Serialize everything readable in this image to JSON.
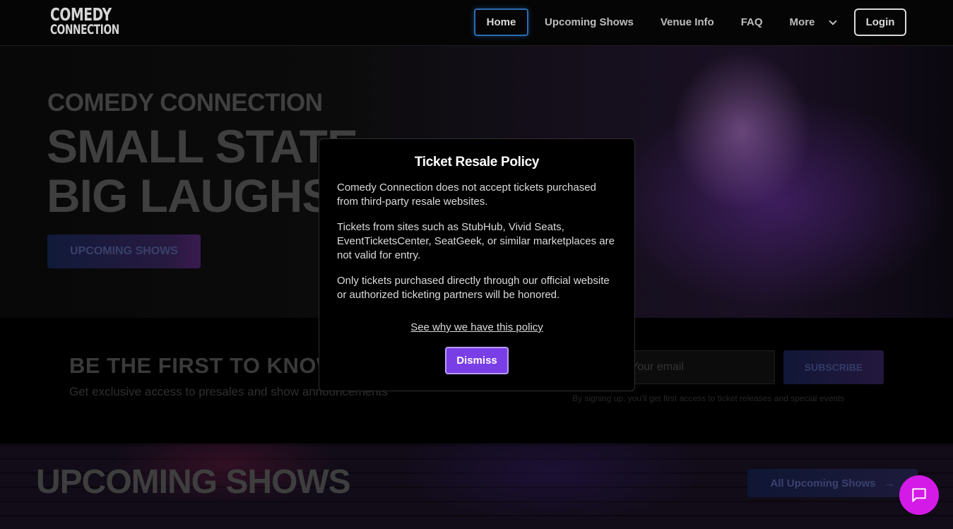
{
  "header": {
    "logo": {
      "line1": "COMEDY",
      "line2": "CONNECTION"
    },
    "nav": [
      {
        "label": "Home",
        "active": true
      },
      {
        "label": "Upcoming Shows"
      },
      {
        "label": "Venue Info"
      },
      {
        "label": "FAQ"
      },
      {
        "label": "More",
        "icon": "chevron-down-icon"
      }
    ],
    "login_label": "Login"
  },
  "hero": {
    "subtitle": "COMEDY CONNECTION",
    "title_line1": "SMALL STATE",
    "title_line2": "BIG LAUGHS",
    "button_label": "UPCOMING SHOWS"
  },
  "newsletter": {
    "title": "BE THE FIRST TO KNOW",
    "subtitle": "Get exclusive access to presales and show announcements",
    "email_placeholder": "Your email",
    "subscribe_label": "SUBSCRIBE",
    "note": "By signing up, you'll get first access to ticket releases and special events"
  },
  "shows": {
    "title": "UPCOMING SHOWS",
    "all_label": "All Upcoming Shows",
    "arrow": "→"
  },
  "modal": {
    "title": "Ticket Resale Policy",
    "paragraph1": "Comedy Connection does not accept tickets purchased from third-party resale websites.",
    "paragraph2": "Tickets from sites such as StubHub, Vivid Seats, EventTicketsCenter, SeatGeek, or similar marketplaces are not valid for entry.",
    "paragraph3": "Only tickets purchased directly through our official website or authorized ticketing partners will be honored.",
    "link_label": "See why we have this policy",
    "dismiss_label": "Dismiss"
  },
  "chat": {
    "icon": "chat-bubble-icon"
  },
  "colors": {
    "accent_purple": "#7a3ee6",
    "chat_magenta": "#d41ae6",
    "active_nav_border": "#2b6db0"
  }
}
